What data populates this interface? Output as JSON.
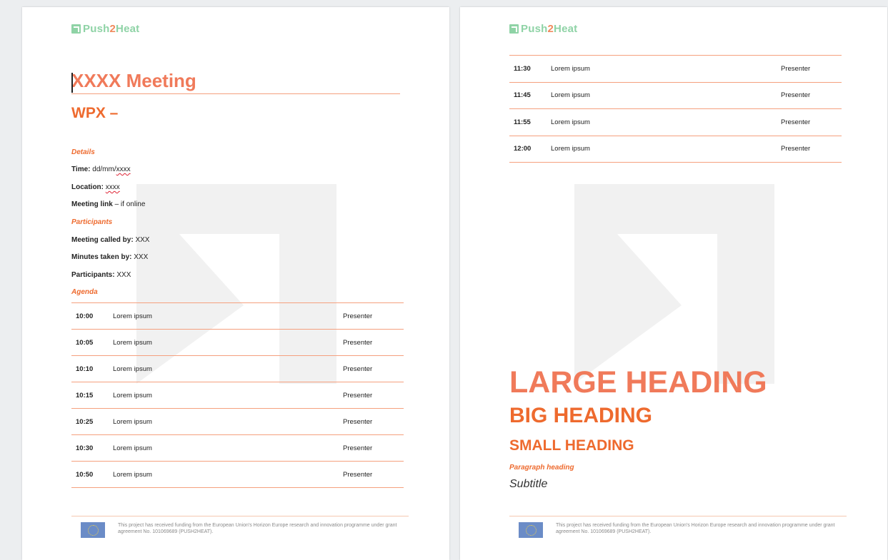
{
  "colors": {
    "accent": "#f07a5a",
    "accent_dark": "#ee6a2e",
    "logo_green": "#8fd3a6",
    "rule": "#f5a07e"
  },
  "logo": {
    "part1": "Push",
    "part2": "2",
    "part3": "Heat"
  },
  "page1": {
    "title": "XXXX Meeting",
    "wp": "WPX –",
    "details_heading": "Details",
    "time_label": "Time:",
    "time_value": "dd/mm/",
    "time_value_squiggle": "xxxx",
    "location_label": "Location:",
    "location_value": "xxxx",
    "meeting_link_label": "Meeting link",
    "meeting_link_value": " – if online",
    "participants_heading": "Participants",
    "called_by_label": "Meeting called by:",
    "called_by_value": " XXX",
    "minutes_label": "Minutes taken by:",
    "minutes_value": " XXX",
    "participants_label": "Participants:",
    "participants_value": " XXX",
    "agenda_heading": "Agenda",
    "agenda": [
      {
        "time": "10:00",
        "item": "Lorem ipsum",
        "presenter": "Presenter"
      },
      {
        "time": "10:05",
        "item": "Lorem ipsum",
        "presenter": "Presenter"
      },
      {
        "time": "10:10",
        "item": "Lorem ipsum",
        "presenter": "Presenter"
      },
      {
        "time": "10:15",
        "item": "Lorem ipsum",
        "presenter": "Presenter"
      },
      {
        "time": "10:25",
        "item": "Lorem ipsum",
        "presenter": "Presenter"
      },
      {
        "time": "10:30",
        "item": "Lorem ipsum",
        "presenter": "Presenter"
      },
      {
        "time": "10:50",
        "item": "Lorem ipsum",
        "presenter": "Presenter"
      }
    ]
  },
  "page2": {
    "agenda": [
      {
        "time": "11:30",
        "item": "Lorem ipsum",
        "presenter": "Presenter"
      },
      {
        "time": "11:45",
        "item": "Lorem ipsum",
        "presenter": "Presenter"
      },
      {
        "time": "11:55",
        "item": "Lorem ipsum",
        "presenter": "Presenter"
      },
      {
        "time": "12:00",
        "item": "Lorem ipsum",
        "presenter": "Presenter"
      }
    ],
    "large_heading": "LARGE HEADING",
    "big_heading": "BIG HEADING",
    "small_heading": "SMALL HEADING",
    "paragraph_heading": "Paragraph heading",
    "subtitle": "Subtitle"
  },
  "footer": {
    "text": "This project has received funding from the European Union's Horizon Europe research and innovation programme under grant agreement No. 101069689 (PUSH2HEAT)."
  }
}
